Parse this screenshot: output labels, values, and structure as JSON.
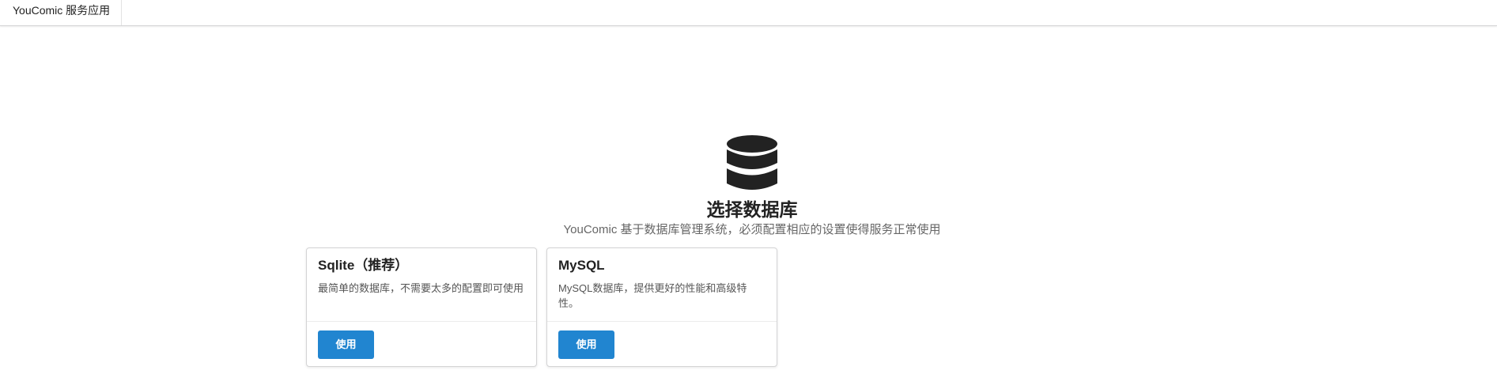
{
  "menu": {
    "app_title": "YouComic 服务应用"
  },
  "header": {
    "icon": "database-icon",
    "title": "选择数据库",
    "subtitle": "YouComic 基于数据库管理系统，必须配置相应的设置使得服务正常使用"
  },
  "options": [
    {
      "name": "Sqlite（推荐）",
      "description": "最简单的数据库，不需要太多的配置即可使用",
      "button_label": "使用"
    },
    {
      "name": "MySQL",
      "description": "MySQL数据库，提供更好的性能和高级特性。",
      "button_label": "使用"
    }
  ],
  "colors": {
    "accent": "#2185d0",
    "icon": "#222222",
    "border": "#d4d4d5"
  }
}
